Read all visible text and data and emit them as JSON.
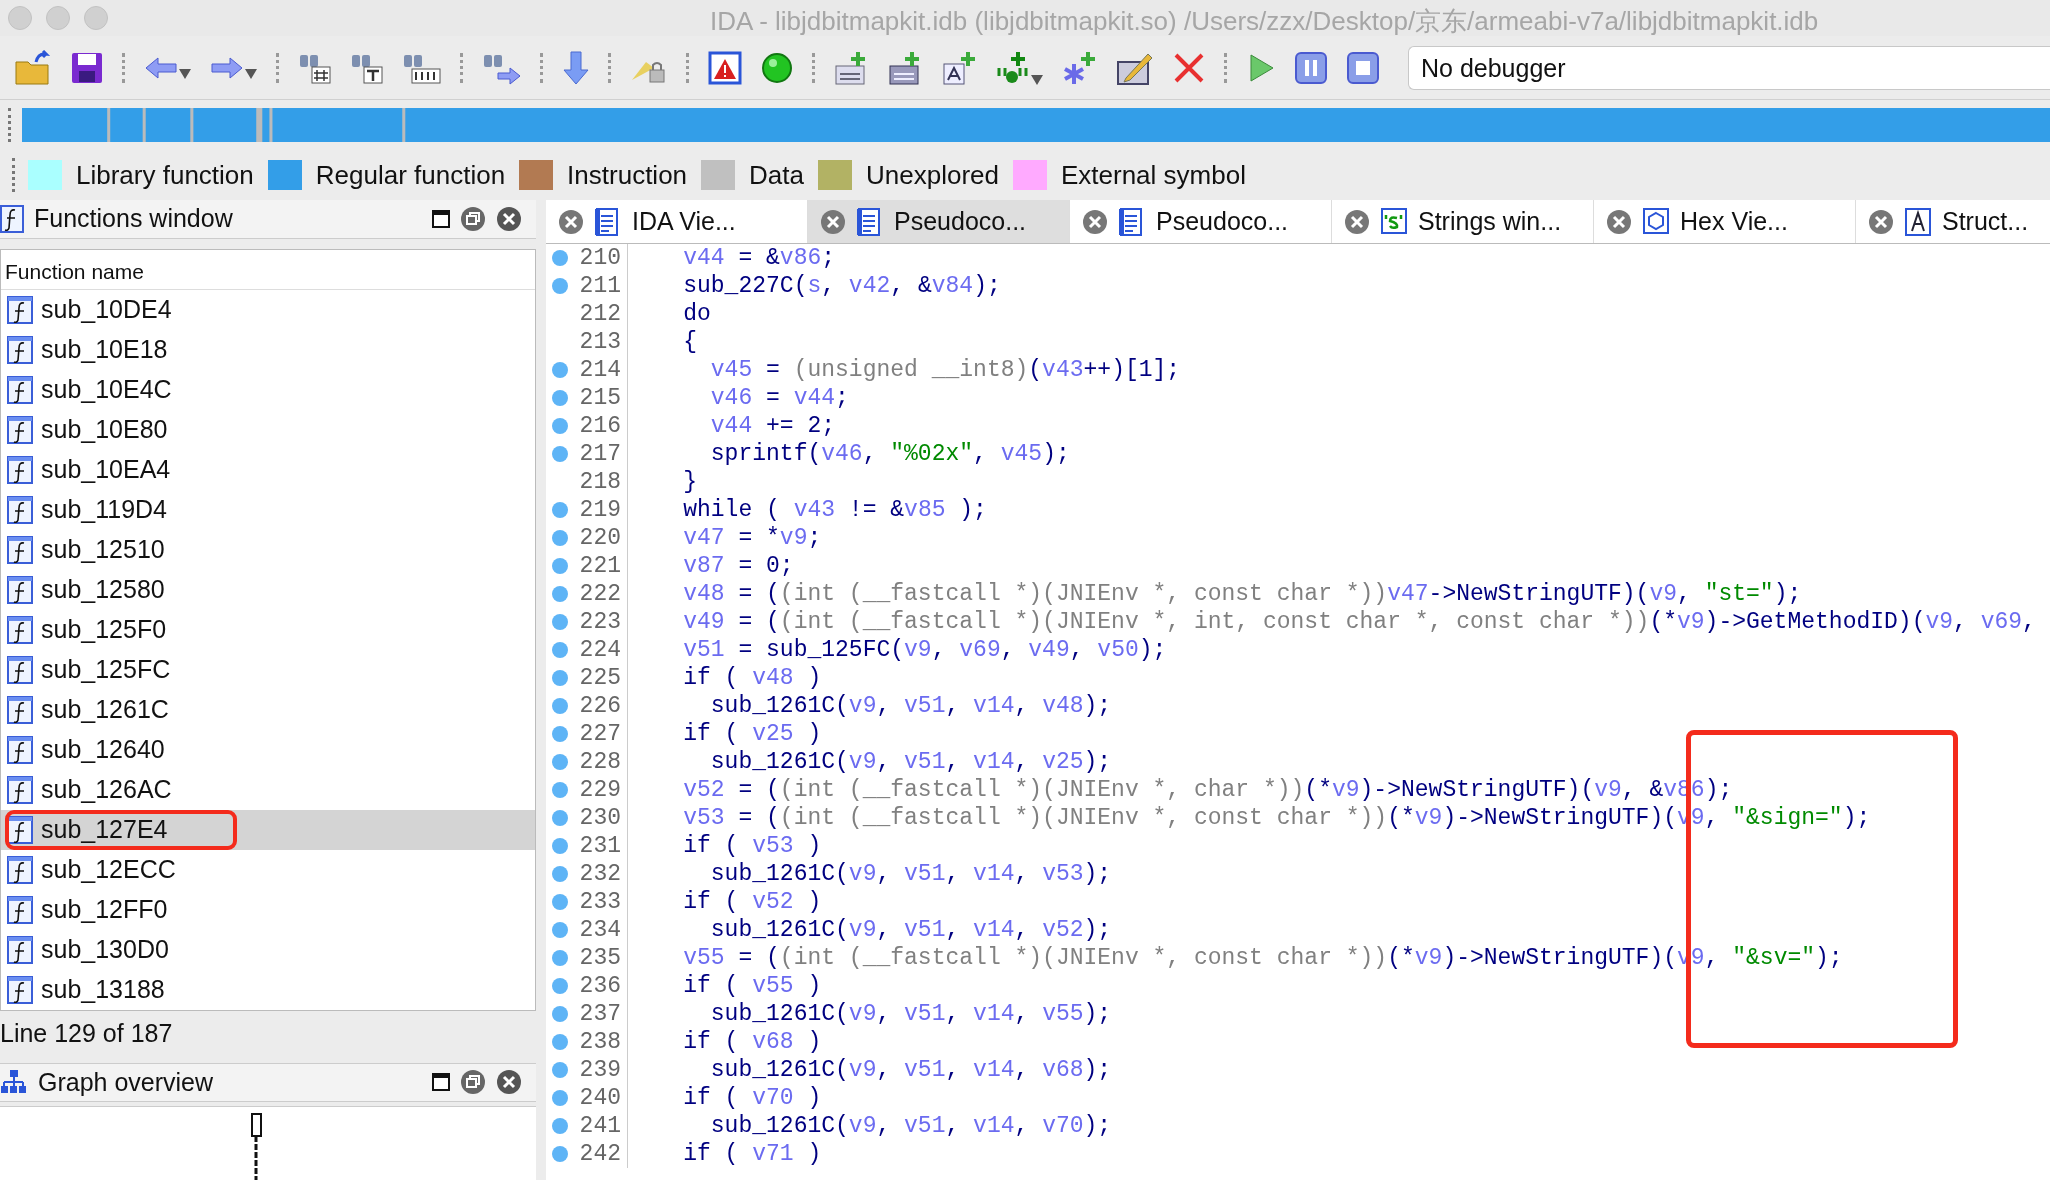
{
  "window": {
    "title": "IDA - libjdbitmapkit.idb (libjdbitmapkit.so) /Users/zzx/Desktop/京东/armeabi-v7a/libjdbitmapkit.idb"
  },
  "toolbar": {
    "debugger": "No debugger"
  },
  "legend": [
    {
      "label": "Library function",
      "color": "#aaffff"
    },
    {
      "label": "Regular function",
      "color": "#339ee8"
    },
    {
      "label": "Instruction",
      "color": "#b27a52"
    },
    {
      "label": "Data",
      "color": "#c0c0c0"
    },
    {
      "label": "Unexplored",
      "color": "#b2b264"
    },
    {
      "label": "External symbol",
      "color": "#ffaaff"
    }
  ],
  "functions_window": {
    "title": "Functions window",
    "column": "Function name",
    "items": [
      {
        "name": "sub_10DE4",
        "selected": false,
        "highlighted": false
      },
      {
        "name": "sub_10E18",
        "selected": false,
        "highlighted": false
      },
      {
        "name": "sub_10E4C",
        "selected": false,
        "highlighted": false
      },
      {
        "name": "sub_10E80",
        "selected": false,
        "highlighted": false
      },
      {
        "name": "sub_10EA4",
        "selected": false,
        "highlighted": false
      },
      {
        "name": "sub_119D4",
        "selected": false,
        "highlighted": false
      },
      {
        "name": "sub_12510",
        "selected": false,
        "highlighted": false
      },
      {
        "name": "sub_12580",
        "selected": false,
        "highlighted": false
      },
      {
        "name": "sub_125F0",
        "selected": false,
        "highlighted": false
      },
      {
        "name": "sub_125FC",
        "selected": false,
        "highlighted": false
      },
      {
        "name": "sub_1261C",
        "selected": false,
        "highlighted": false
      },
      {
        "name": "sub_12640",
        "selected": false,
        "highlighted": false
      },
      {
        "name": "sub_126AC",
        "selected": false,
        "highlighted": false
      },
      {
        "name": "sub_127E4",
        "selected": true,
        "highlighted": true
      },
      {
        "name": "sub_12ECC",
        "selected": false,
        "highlighted": false
      },
      {
        "name": "sub_12FF0",
        "selected": false,
        "highlighted": false
      },
      {
        "name": "sub_130D0",
        "selected": false,
        "highlighted": false
      },
      {
        "name": "sub_13188",
        "selected": false,
        "highlighted": false
      }
    ],
    "status": "Line 129 of 187"
  },
  "graph_overview": {
    "title": "Graph overview"
  },
  "tabs": [
    {
      "label": "IDA Vie...",
      "kind": "disassembly",
      "selected": false
    },
    {
      "label": "Pseudoco...",
      "kind": "pseudocode",
      "selected": true
    },
    {
      "label": "Pseudoco...",
      "kind": "pseudocode",
      "selected": false
    },
    {
      "label": "Strings win...",
      "kind": "strings",
      "selected": false
    },
    {
      "label": "Hex Vie...",
      "kind": "hex",
      "selected": false
    },
    {
      "label": "Struct...",
      "kind": "structures",
      "selected": false
    }
  ],
  "code": {
    "annotation_box": true,
    "lines": [
      {
        "number": "210",
        "dot": true,
        "segments": [
          {
            "kind": "v",
            "text": "    v44"
          },
          {
            "kind": "c",
            "text": " = &"
          },
          {
            "kind": "v",
            "text": "v86"
          },
          {
            "kind": "c",
            "text": ";"
          }
        ]
      },
      {
        "number": "211",
        "dot": true,
        "segments": [
          {
            "kind": "c",
            "text": "    sub_227C("
          },
          {
            "kind": "v",
            "text": "s"
          },
          {
            "kind": "c",
            "text": ", "
          },
          {
            "kind": "v",
            "text": "v42"
          },
          {
            "kind": "c",
            "text": ", &"
          },
          {
            "kind": "v",
            "text": "v84"
          },
          {
            "kind": "c",
            "text": ");"
          }
        ]
      },
      {
        "number": "212",
        "dot": false,
        "segments": [
          {
            "kind": "c",
            "text": "    do"
          }
        ]
      },
      {
        "number": "213",
        "dot": false,
        "segments": [
          {
            "kind": "c",
            "text": "    {"
          }
        ]
      },
      {
        "number": "214",
        "dot": true,
        "segments": [
          {
            "kind": "v",
            "text": "      v45"
          },
          {
            "kind": "c",
            "text": " = "
          },
          {
            "kind": "t",
            "text": "(unsigned __int8)"
          },
          {
            "kind": "c",
            "text": "("
          },
          {
            "kind": "v",
            "text": "v43"
          },
          {
            "kind": "c",
            "text": "++)[1];"
          }
        ]
      },
      {
        "number": "215",
        "dot": true,
        "segments": [
          {
            "kind": "v",
            "text": "      v46"
          },
          {
            "kind": "c",
            "text": " = "
          },
          {
            "kind": "v",
            "text": "v44"
          },
          {
            "kind": "c",
            "text": ";"
          }
        ]
      },
      {
        "number": "216",
        "dot": true,
        "segments": [
          {
            "kind": "v",
            "text": "      v44"
          },
          {
            "kind": "c",
            "text": " += 2;"
          }
        ]
      },
      {
        "number": "217",
        "dot": true,
        "segments": [
          {
            "kind": "c",
            "text": "      sprintf("
          },
          {
            "kind": "v",
            "text": "v46"
          },
          {
            "kind": "c",
            "text": ", "
          },
          {
            "kind": "s",
            "text": "\"%02x\""
          },
          {
            "kind": "c",
            "text": ", "
          },
          {
            "kind": "v",
            "text": "v45"
          },
          {
            "kind": "c",
            "text": ");"
          }
        ]
      },
      {
        "number": "218",
        "dot": false,
        "segments": [
          {
            "kind": "c",
            "text": "    }"
          }
        ]
      },
      {
        "number": "219",
        "dot": true,
        "segments": [
          {
            "kind": "c",
            "text": "    while ( "
          },
          {
            "kind": "v",
            "text": "v43"
          },
          {
            "kind": "c",
            "text": " != &"
          },
          {
            "kind": "v",
            "text": "v85"
          },
          {
            "kind": "c",
            "text": " );"
          }
        ]
      },
      {
        "number": "220",
        "dot": true,
        "segments": [
          {
            "kind": "v",
            "text": "    v47"
          },
          {
            "kind": "c",
            "text": " = *"
          },
          {
            "kind": "v",
            "text": "v9"
          },
          {
            "kind": "c",
            "text": ";"
          }
        ]
      },
      {
        "number": "221",
        "dot": true,
        "segments": [
          {
            "kind": "v",
            "text": "    v87"
          },
          {
            "kind": "c",
            "text": " = 0;"
          }
        ]
      },
      {
        "number": "222",
        "dot": true,
        "segments": [
          {
            "kind": "v",
            "text": "    v48"
          },
          {
            "kind": "c",
            "text": " = ("
          },
          {
            "kind": "t",
            "text": "(int (__fastcall *)(JNIEnv *, const char *))"
          },
          {
            "kind": "v",
            "text": "v47"
          },
          {
            "kind": "c",
            "text": "->NewStringUTF)("
          },
          {
            "kind": "v",
            "text": "v9"
          },
          {
            "kind": "c",
            "text": ", "
          },
          {
            "kind": "s",
            "text": "\"st=\""
          },
          {
            "kind": "c",
            "text": ");"
          }
        ]
      },
      {
        "number": "223",
        "dot": true,
        "segments": [
          {
            "kind": "v",
            "text": "    v49"
          },
          {
            "kind": "c",
            "text": " = ("
          },
          {
            "kind": "t",
            "text": "(int (__fastcall *)(JNIEnv *, int, const char *, const char *))"
          },
          {
            "kind": "c",
            "text": "(*"
          },
          {
            "kind": "v",
            "text": "v9"
          },
          {
            "kind": "c",
            "text": ")->GetMethodID)("
          },
          {
            "kind": "v",
            "text": "v9"
          },
          {
            "kind": "c",
            "text": ", "
          },
          {
            "kind": "v",
            "text": "v69"
          },
          {
            "kind": "c",
            "text": ","
          }
        ]
      },
      {
        "number": "224",
        "dot": true,
        "segments": [
          {
            "kind": "v",
            "text": "    v51"
          },
          {
            "kind": "c",
            "text": " = sub_125FC("
          },
          {
            "kind": "v",
            "text": "v9"
          },
          {
            "kind": "c",
            "text": ", "
          },
          {
            "kind": "v",
            "text": "v69"
          },
          {
            "kind": "c",
            "text": ", "
          },
          {
            "kind": "v",
            "text": "v49"
          },
          {
            "kind": "c",
            "text": ", "
          },
          {
            "kind": "v",
            "text": "v50"
          },
          {
            "kind": "c",
            "text": ");"
          }
        ]
      },
      {
        "number": "225",
        "dot": true,
        "segments": [
          {
            "kind": "c",
            "text": "    if ( "
          },
          {
            "kind": "v",
            "text": "v48"
          },
          {
            "kind": "c",
            "text": " )"
          }
        ]
      },
      {
        "number": "226",
        "dot": true,
        "segments": [
          {
            "kind": "c",
            "text": "      sub_1261C("
          },
          {
            "kind": "v",
            "text": "v9"
          },
          {
            "kind": "c",
            "text": ", "
          },
          {
            "kind": "v",
            "text": "v51"
          },
          {
            "kind": "c",
            "text": ", "
          },
          {
            "kind": "v",
            "text": "v14"
          },
          {
            "kind": "c",
            "text": ", "
          },
          {
            "kind": "v",
            "text": "v48"
          },
          {
            "kind": "c",
            "text": ");"
          }
        ]
      },
      {
        "number": "227",
        "dot": true,
        "segments": [
          {
            "kind": "c",
            "text": "    if ( "
          },
          {
            "kind": "v",
            "text": "v25"
          },
          {
            "kind": "c",
            "text": " )"
          }
        ]
      },
      {
        "number": "228",
        "dot": true,
        "segments": [
          {
            "kind": "c",
            "text": "      sub_1261C("
          },
          {
            "kind": "v",
            "text": "v9"
          },
          {
            "kind": "c",
            "text": ", "
          },
          {
            "kind": "v",
            "text": "v51"
          },
          {
            "kind": "c",
            "text": ", "
          },
          {
            "kind": "v",
            "text": "v14"
          },
          {
            "kind": "c",
            "text": ", "
          },
          {
            "kind": "v",
            "text": "v25"
          },
          {
            "kind": "c",
            "text": ");"
          }
        ]
      },
      {
        "number": "229",
        "dot": true,
        "segments": [
          {
            "kind": "v",
            "text": "    v52"
          },
          {
            "kind": "c",
            "text": " = ("
          },
          {
            "kind": "t",
            "text": "(int (__fastcall *)(JNIEnv *, char *))"
          },
          {
            "kind": "c",
            "text": "(*"
          },
          {
            "kind": "v",
            "text": "v9"
          },
          {
            "kind": "c",
            "text": ")->NewStringUTF)("
          },
          {
            "kind": "v",
            "text": "v9"
          },
          {
            "kind": "c",
            "text": ", &"
          },
          {
            "kind": "v",
            "text": "v86"
          },
          {
            "kind": "c",
            "text": ");"
          }
        ]
      },
      {
        "number": "230",
        "dot": true,
        "segments": [
          {
            "kind": "v",
            "text": "    v53"
          },
          {
            "kind": "c",
            "text": " = ("
          },
          {
            "kind": "t",
            "text": "(int (__fastcall *)(JNIEnv *, const char *))"
          },
          {
            "kind": "c",
            "text": "(*"
          },
          {
            "kind": "v",
            "text": "v9"
          },
          {
            "kind": "c",
            "text": ")->NewStringUTF)("
          },
          {
            "kind": "v",
            "text": "v9"
          },
          {
            "kind": "c",
            "text": ", "
          },
          {
            "kind": "s",
            "text": "\"&sign=\""
          },
          {
            "kind": "c",
            "text": ");"
          }
        ]
      },
      {
        "number": "231",
        "dot": true,
        "segments": [
          {
            "kind": "c",
            "text": "    if ( "
          },
          {
            "kind": "v",
            "text": "v53"
          },
          {
            "kind": "c",
            "text": " )"
          }
        ]
      },
      {
        "number": "232",
        "dot": true,
        "segments": [
          {
            "kind": "c",
            "text": "      sub_1261C("
          },
          {
            "kind": "v",
            "text": "v9"
          },
          {
            "kind": "c",
            "text": ", "
          },
          {
            "kind": "v",
            "text": "v51"
          },
          {
            "kind": "c",
            "text": ", "
          },
          {
            "kind": "v",
            "text": "v14"
          },
          {
            "kind": "c",
            "text": ", "
          },
          {
            "kind": "v",
            "text": "v53"
          },
          {
            "kind": "c",
            "text": ");"
          }
        ]
      },
      {
        "number": "233",
        "dot": true,
        "segments": [
          {
            "kind": "c",
            "text": "    if ( "
          },
          {
            "kind": "v",
            "text": "v52"
          },
          {
            "kind": "c",
            "text": " )"
          }
        ]
      },
      {
        "number": "234",
        "dot": true,
        "segments": [
          {
            "kind": "c",
            "text": "      sub_1261C("
          },
          {
            "kind": "v",
            "text": "v9"
          },
          {
            "kind": "c",
            "text": ", "
          },
          {
            "kind": "v",
            "text": "v51"
          },
          {
            "kind": "c",
            "text": ", "
          },
          {
            "kind": "v",
            "text": "v14"
          },
          {
            "kind": "c",
            "text": ", "
          },
          {
            "kind": "v",
            "text": "v52"
          },
          {
            "kind": "c",
            "text": ");"
          }
        ]
      },
      {
        "number": "235",
        "dot": true,
        "segments": [
          {
            "kind": "v",
            "text": "    v55"
          },
          {
            "kind": "c",
            "text": " = ("
          },
          {
            "kind": "t",
            "text": "(int (__fastcall *)(JNIEnv *, const char *))"
          },
          {
            "kind": "c",
            "text": "(*"
          },
          {
            "kind": "v",
            "text": "v9"
          },
          {
            "kind": "c",
            "text": ")->NewStringUTF)("
          },
          {
            "kind": "v",
            "text": "v9"
          },
          {
            "kind": "c",
            "text": ", "
          },
          {
            "kind": "s",
            "text": "\"&sv=\""
          },
          {
            "kind": "c",
            "text": ");"
          }
        ]
      },
      {
        "number": "236",
        "dot": true,
        "segments": [
          {
            "kind": "c",
            "text": "    if ( "
          },
          {
            "kind": "v",
            "text": "v55"
          },
          {
            "kind": "c",
            "text": " )"
          }
        ]
      },
      {
        "number": "237",
        "dot": true,
        "segments": [
          {
            "kind": "c",
            "text": "      sub_1261C("
          },
          {
            "kind": "v",
            "text": "v9"
          },
          {
            "kind": "c",
            "text": ", "
          },
          {
            "kind": "v",
            "text": "v51"
          },
          {
            "kind": "c",
            "text": ", "
          },
          {
            "kind": "v",
            "text": "v14"
          },
          {
            "kind": "c",
            "text": ", "
          },
          {
            "kind": "v",
            "text": "v55"
          },
          {
            "kind": "c",
            "text": ");"
          }
        ]
      },
      {
        "number": "238",
        "dot": true,
        "segments": [
          {
            "kind": "c",
            "text": "    if ( "
          },
          {
            "kind": "v",
            "text": "v68"
          },
          {
            "kind": "c",
            "text": " )"
          }
        ]
      },
      {
        "number": "239",
        "dot": true,
        "segments": [
          {
            "kind": "c",
            "text": "      sub_1261C("
          },
          {
            "kind": "v",
            "text": "v9"
          },
          {
            "kind": "c",
            "text": ", "
          },
          {
            "kind": "v",
            "text": "v51"
          },
          {
            "kind": "c",
            "text": ", "
          },
          {
            "kind": "v",
            "text": "v14"
          },
          {
            "kind": "c",
            "text": ", "
          },
          {
            "kind": "v",
            "text": "v68"
          },
          {
            "kind": "c",
            "text": ");"
          }
        ]
      },
      {
        "number": "240",
        "dot": true,
        "segments": [
          {
            "kind": "c",
            "text": "    if ( "
          },
          {
            "kind": "v",
            "text": "v70"
          },
          {
            "kind": "c",
            "text": " )"
          }
        ]
      },
      {
        "number": "241",
        "dot": true,
        "segments": [
          {
            "kind": "c",
            "text": "      sub_1261C("
          },
          {
            "kind": "v",
            "text": "v9"
          },
          {
            "kind": "c",
            "text": ", "
          },
          {
            "kind": "v",
            "text": "v51"
          },
          {
            "kind": "c",
            "text": ", "
          },
          {
            "kind": "v",
            "text": "v14"
          },
          {
            "kind": "c",
            "text": ", "
          },
          {
            "kind": "v",
            "text": "v70"
          },
          {
            "kind": "c",
            "text": ");"
          }
        ]
      },
      {
        "number": "242",
        "dot": true,
        "segments": [
          {
            "kind": "c",
            "text": "    if ( "
          },
          {
            "kind": "v",
            "text": "v71"
          },
          {
            "kind": "c",
            "text": " )"
          }
        ]
      }
    ]
  }
}
